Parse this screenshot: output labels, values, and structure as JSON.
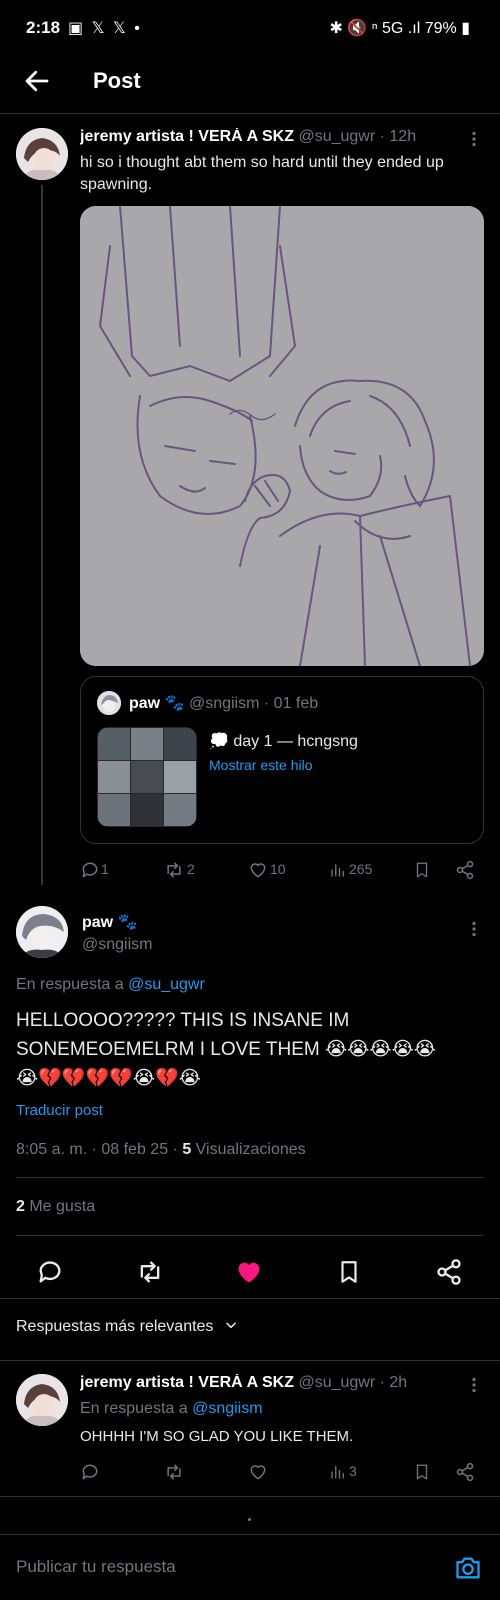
{
  "status_bar": {
    "time": "2:18",
    "battery": "79%",
    "notification_glyphs": "▣ 𝕏 𝕏 •",
    "indicator_glyphs": "✱ 🔇 ⁿ 5G .ıl"
  },
  "header": {
    "title": "Post"
  },
  "parent_tweet": {
    "name": "jeremy artista ! VERÁ A SKZ",
    "handle": "@su_ugwr",
    "time": "· 12h",
    "text": "hi so i thought abt them so hard until they ended up spawning.",
    "quote": {
      "name": "paw",
      "name_emoji": "🐾",
      "handle": "@sngiism",
      "date": "· 01 feb",
      "text_emoji": "💭",
      "text": "day 1 — hcngsng",
      "link": "Mostrar este hilo"
    },
    "stats": {
      "replies": "1",
      "retweets": "2",
      "likes": "10",
      "views": "265"
    }
  },
  "main_tweet": {
    "name": "paw",
    "name_emoji": "🐾",
    "handle": "@sngiism",
    "reply_prefix": "En respuesta a",
    "reply_to": "@su_ugwr",
    "text_line1": "HELLOOOO????? THIS IS INSANE IM",
    "text_line2": "SONEMEOEMELRM I LOVE THEM 😭😭😭😭😭",
    "text_line3": "😭💔💔💔💔😭💔😭",
    "translate": "Traducir post",
    "timestamp": "8:05 a. m. · 08 feb 25 · ",
    "views_count": "5",
    "views_label": " Visualizaciones",
    "likes_count": "2",
    "likes_label": " Me gusta",
    "like_color": "#f91880"
  },
  "replies_sort": {
    "label": "Respuestas más relevantes"
  },
  "reply_tweet": {
    "name": "jeremy artista ! VERÁ A SKZ",
    "handle": "@su_ugwr",
    "time": "· 2h",
    "reply_prefix": "En respuesta a",
    "reply_to": "@sngiism",
    "text": "OHHHH I'M SO GLAD YOU LIKE THEM.",
    "views": "3"
  },
  "composer": {
    "placeholder": "Publicar tu respuesta"
  },
  "colors": {
    "accent": "#1d9bf0",
    "background": "#000000",
    "muted": "#71767b"
  }
}
